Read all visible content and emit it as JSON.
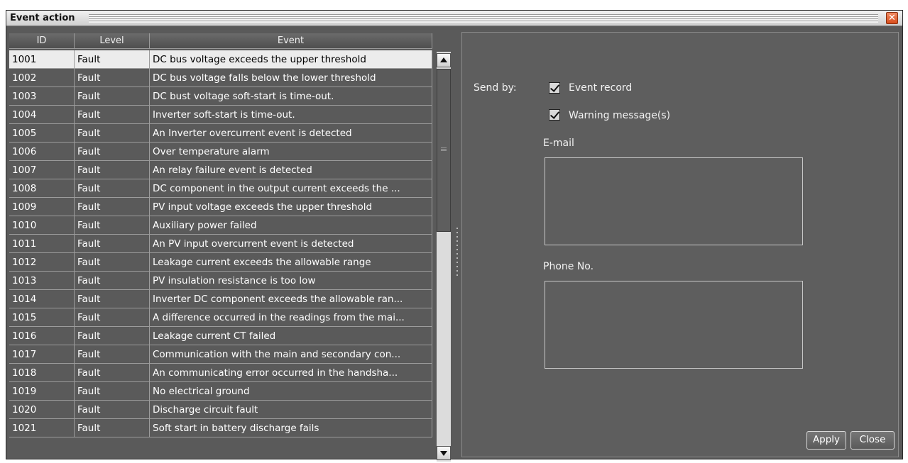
{
  "window": {
    "title": "Event action",
    "close_symbol": "✕"
  },
  "table": {
    "columns": [
      "ID",
      "Level",
      "Event"
    ],
    "selected_index": 0,
    "rows": [
      {
        "id": "1001",
        "level": "Fault",
        "event": "DC bus voltage exceeds the upper threshold"
      },
      {
        "id": "1002",
        "level": "Fault",
        "event": "DC bus voltage falls below the lower threshold"
      },
      {
        "id": "1003",
        "level": "Fault",
        "event": "DC bust voltage soft-start is time-out."
      },
      {
        "id": "1004",
        "level": "Fault",
        "event": "Inverter soft-start is time-out."
      },
      {
        "id": "1005",
        "level": "Fault",
        "event": "An Inverter overcurrent event is detected"
      },
      {
        "id": "1006",
        "level": "Fault",
        "event": "Over temperature alarm"
      },
      {
        "id": "1007",
        "level": "Fault",
        "event": "An relay failure event is detected"
      },
      {
        "id": "1008",
        "level": "Fault",
        "event": "DC component in the output current exceeds the ..."
      },
      {
        "id": "1009",
        "level": "Fault",
        "event": "PV input voltage exceeds the upper threshold"
      },
      {
        "id": "1010",
        "level": "Fault",
        "event": "Auxiliary power failed"
      },
      {
        "id": "1011",
        "level": "Fault",
        "event": "An PV input overcurrent event is detected"
      },
      {
        "id": "1012",
        "level": "Fault",
        "event": "Leakage current exceeds the allowable range"
      },
      {
        "id": "1013",
        "level": "Fault",
        "event": "PV insulation resistance is too low"
      },
      {
        "id": "1014",
        "level": "Fault",
        "event": "Inverter DC component exceeds the allowable ran..."
      },
      {
        "id": "1015",
        "level": "Fault",
        "event": "A difference occurred in the readings from the mai..."
      },
      {
        "id": "1016",
        "level": "Fault",
        "event": "Leakage current CT failed"
      },
      {
        "id": "1017",
        "level": "Fault",
        "event": "Communication with the main and secondary con..."
      },
      {
        "id": "1018",
        "level": "Fault",
        "event": "An communicating error occurred in the handsha..."
      },
      {
        "id": "1019",
        "level": "Fault",
        "event": "No electrical ground"
      },
      {
        "id": "1020",
        "level": "Fault",
        "event": "Discharge circuit fault"
      },
      {
        "id": "1021",
        "level": "Fault",
        "event": "Soft start in battery discharge fails"
      }
    ]
  },
  "panel": {
    "send_by_label": "Send by:",
    "event_record_label": "Event record",
    "event_record_checked": true,
    "warning_messages_label": "Warning message(s)",
    "warning_messages_checked": true,
    "email_label": "E-mail",
    "email_value": "",
    "phone_label": "Phone No.",
    "phone_value": "",
    "apply_label": "Apply",
    "close_label": "Close"
  },
  "icons": {
    "close": "close-icon",
    "scroll_up": "arrow-up-icon",
    "scroll_down": "arrow-down-icon",
    "checkbox": "checkmark-icon"
  },
  "colors": {
    "background": "#5a5a5a",
    "selected_row": "#ececec",
    "close_button": "#e06a3c"
  }
}
